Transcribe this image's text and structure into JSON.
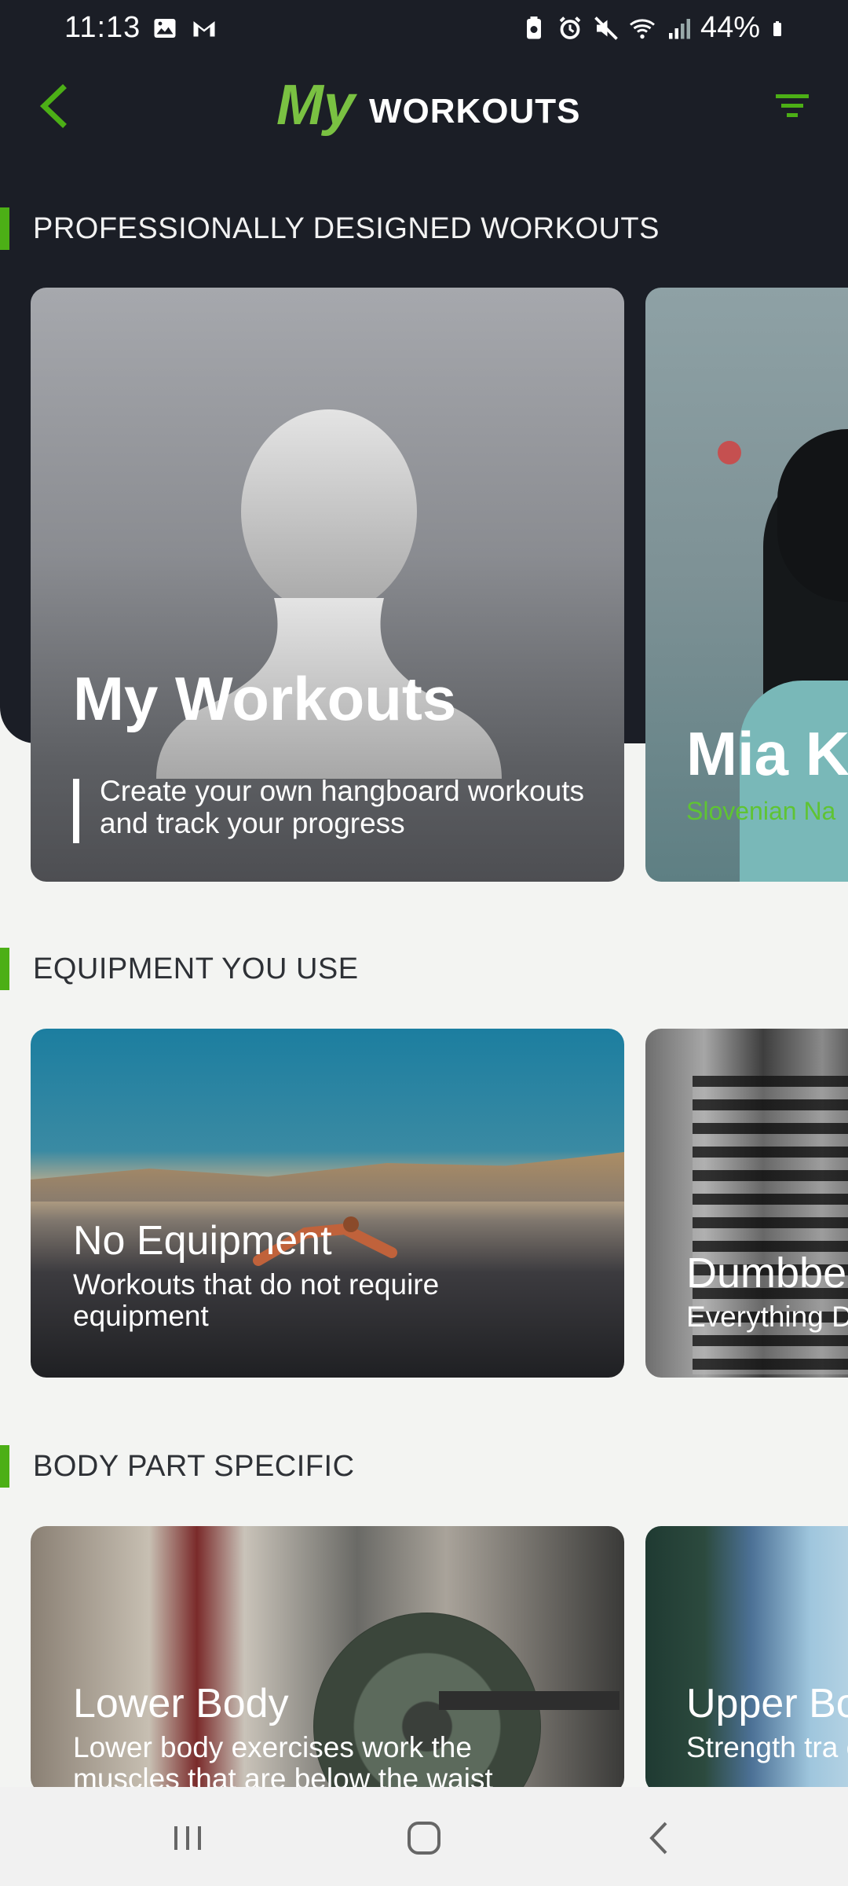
{
  "status_bar": {
    "time": "11:13",
    "battery": "44%",
    "icons": [
      "image-icon",
      "gmail-icon",
      "battery-saver-icon",
      "alarm-icon",
      "mute-icon",
      "wifi-icon",
      "signal-icon",
      "battery-icon"
    ]
  },
  "app_bar": {
    "logo_my": "My",
    "logo_word": "WORKOUTS",
    "accent": "#4caf16"
  },
  "sections": {
    "pro": {
      "title": "PROFESSIONALLY DESIGNED WORKOUTS",
      "cards": [
        {
          "title": "My Workouts",
          "subtitle": "Create your own hangboard workouts and track your progress"
        },
        {
          "title": "Mia K",
          "subtitle": "Slovenian Na"
        }
      ]
    },
    "equipment": {
      "title": "EQUIPMENT YOU USE",
      "cards": [
        {
          "title": "No Equipment",
          "subtitle": "Workouts that do not require equipment"
        },
        {
          "title": "Dumbbel",
          "subtitle": "Everything D"
        }
      ]
    },
    "body": {
      "title": "BODY PART SPECIFIC",
      "cards": [
        {
          "title": "Lower Body",
          "subtitle": "Lower body exercises work the muscles that are below the waist"
        },
        {
          "title": "Upper Bo",
          "subtitle": "Strength tra chest, shou"
        }
      ]
    }
  },
  "nav": {
    "items": [
      "recents-icon",
      "home-icon",
      "back-icon"
    ]
  }
}
